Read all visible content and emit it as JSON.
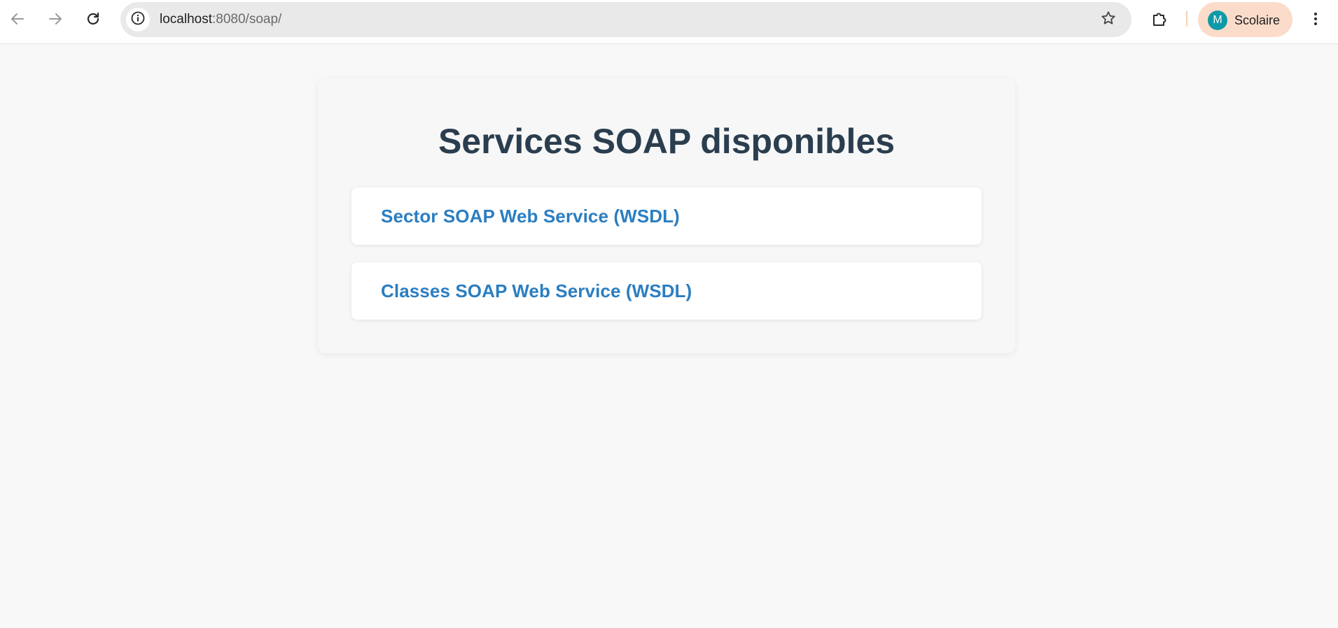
{
  "browser": {
    "url_host": "localhost",
    "url_rest": ":8080/soap/",
    "profile_initial": "M",
    "profile_name": "Scolaire",
    "icons": {
      "back": "arrow-left-icon",
      "forward": "arrow-right-icon",
      "reload": "reload-icon",
      "site_info": "info-icon",
      "bookmark": "star-icon",
      "extensions": "puzzle-icon",
      "menu": "kebab-menu-icon"
    }
  },
  "page": {
    "title": "Services SOAP disponibles",
    "services": [
      {
        "label": "Sector SOAP Web Service (WSDL)"
      },
      {
        "label": "Classes SOAP Web Service (WSDL)"
      }
    ]
  },
  "colors": {
    "page_bg": "#f8f8f8",
    "title": "#2b3e50",
    "link": "#2b7ec1",
    "avatar": "#0f9aa7",
    "profile_chip": "#fbdccb"
  }
}
